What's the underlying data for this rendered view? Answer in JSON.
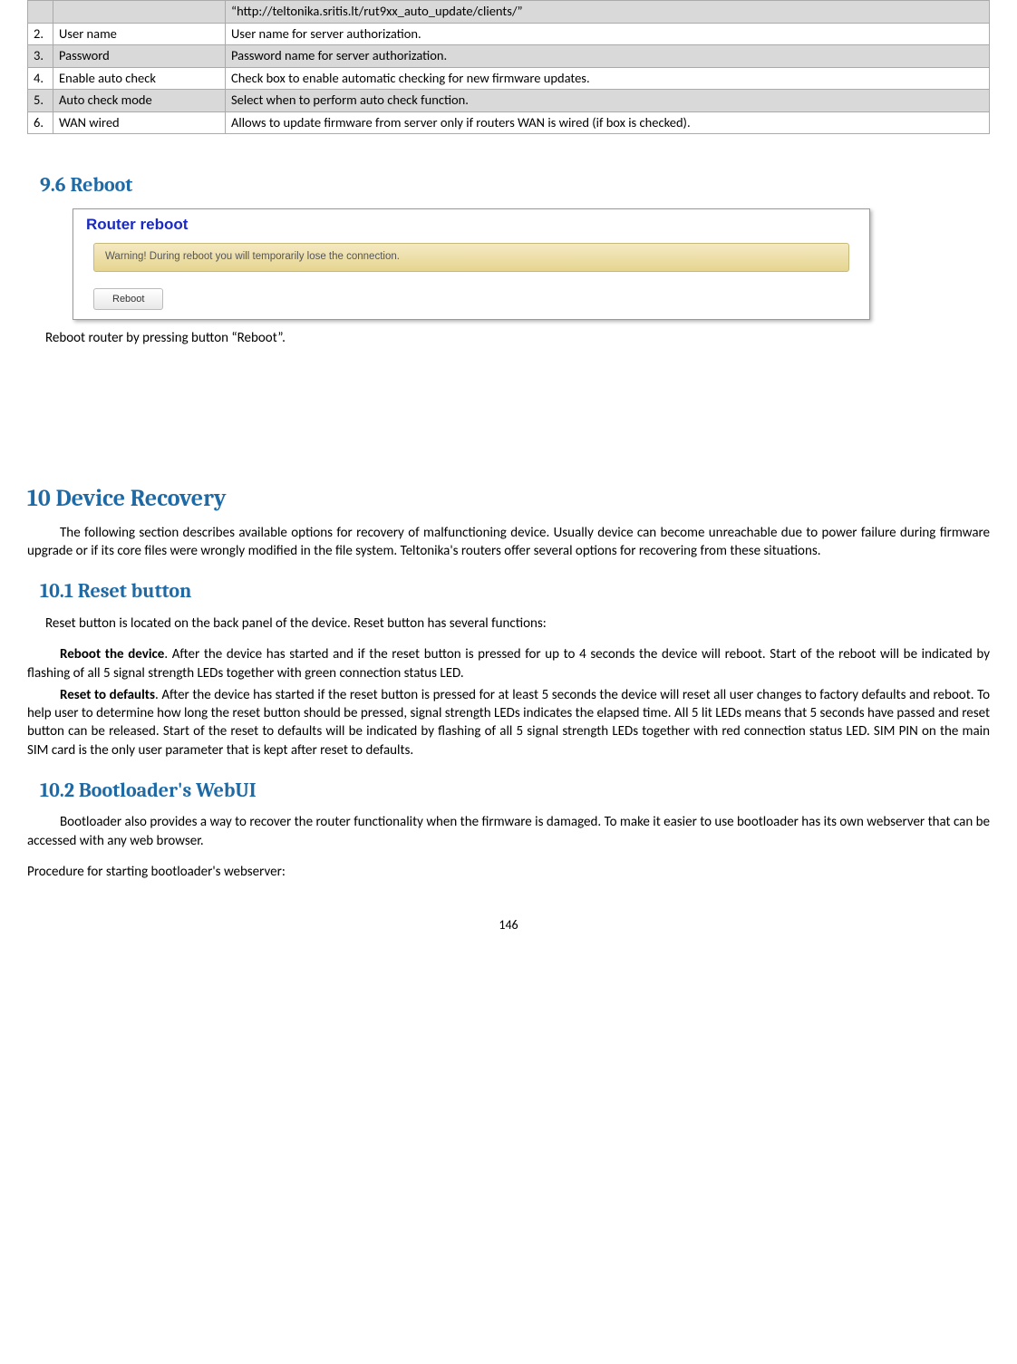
{
  "table": {
    "toprow": {
      "desc": "“http://teltonika.sritis.lt/rut9xx_auto_update/clients/”"
    },
    "rows": [
      {
        "num": "2.",
        "name": "User name",
        "desc": "User name for server authorization."
      },
      {
        "num": "3.",
        "name": "Password",
        "desc": "Password name for server authorization."
      },
      {
        "num": "4.",
        "name": "Enable auto check",
        "desc": "Check box to enable automatic checking for new firmware updates."
      },
      {
        "num": "5.",
        "name": "Auto check mode",
        "desc": "Select when to perform auto check function."
      },
      {
        "num": "6.",
        "name": "WAN wired",
        "desc": "Allows to update firmware from server only if routers WAN is wired (if box is checked)."
      }
    ]
  },
  "sec96": {
    "heading": "9.6   Reboot",
    "panel_title": "Router reboot",
    "panel_warning": "Warning! During reboot you will temporarily lose the connection.",
    "panel_button": "Reboot",
    "caption": "Reboot router by pressing button “Reboot”."
  },
  "sec10": {
    "heading": "10 Device Recovery",
    "para": "The following section describes available options for recovery of malfunctioning device. Usually device can become unreachable due to power failure during firmware upgrade or if its core files were wrongly modified in the file system. Teltonika's routers offer several options for recovering from these situations."
  },
  "sec101": {
    "heading": "10.1 Reset button",
    "p1": "Reset button is located on the back panel of the device. Reset button has several functions:",
    "p2_lead": "Reboot the device",
    "p2_rest": ". After the device has started and if the reset button is pressed for up to 4 seconds the device will reboot. Start of the reboot will be indicated by flashing of all 5 signal strength LEDs together with green connection status LED.",
    "p3_lead": "Reset to defaults",
    "p3_rest": ". After the device has started if the reset button is pressed for at least 5 seconds the device will reset all user changes to factory defaults and reboot. To help user to determine how long the reset button should be pressed, signal strength LEDs indicates the elapsed time. All 5 lit LEDs means that 5 seconds have passed and reset button can be released. Start of the reset to defaults will be indicated by flashing of all 5 signal strength LEDs together with red connection status LED. SIM PIN on the main SIM card is the only user parameter that is kept after reset to defaults."
  },
  "sec102": {
    "heading": "10.2 Bootloader's WebUI",
    "p1": "Bootloader also provides a way to recover the router functionality when the firmware is damaged. To make it easier to use bootloader has its own webserver that can be accessed with any web browser.",
    "p2": "Procedure for starting bootloader's webserver:"
  },
  "page_number": "146"
}
